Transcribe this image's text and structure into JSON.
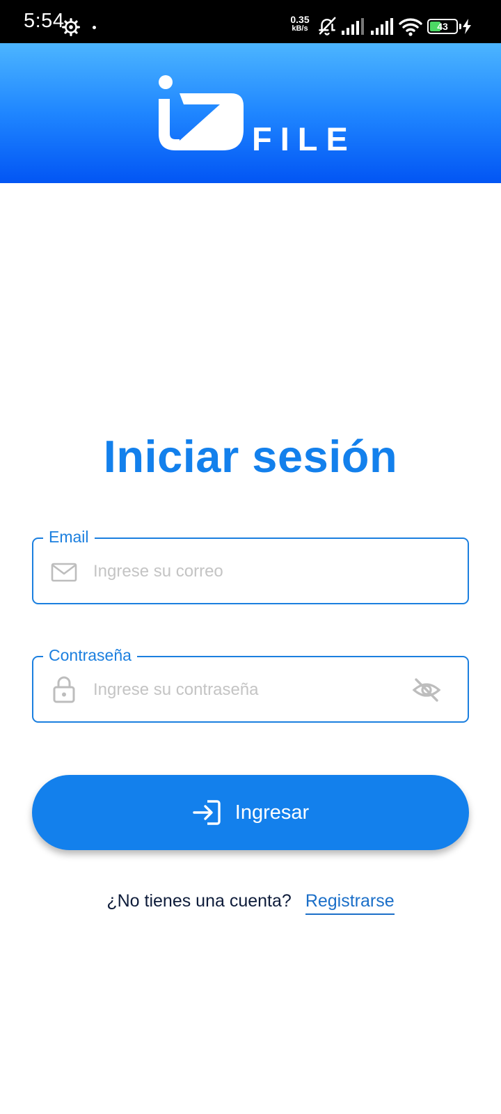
{
  "status_bar": {
    "time": "5:54",
    "net_speed_value": "0.35",
    "net_speed_unit": "kB/s",
    "battery_level": "43",
    "battery_percent": 43,
    "icons": [
      "gear-icon",
      "notifications-off-icon",
      "signal-icon",
      "signal-icon",
      "wifi-icon",
      "battery-icon",
      "charging-bolt-icon"
    ]
  },
  "header": {
    "logo_mark": "IZ",
    "logo_text": "FILE",
    "gradient_top": "#4cb5ff",
    "gradient_bottom": "#0255f4"
  },
  "login": {
    "title": "Iniciar sesión",
    "email": {
      "label": "Email",
      "placeholder": "Ingrese su correo",
      "value": "",
      "icon": "mail-icon"
    },
    "password": {
      "label": "Contraseña",
      "placeholder": "Ingrese su contraseña",
      "value": "",
      "icon": "lock-icon",
      "toggle_icon": "eye-off-icon"
    },
    "submit_label": "Ingresar",
    "submit_icon": "login-icon",
    "signup_question": "¿No tienes una cuenta?",
    "signup_link": "Registrarse"
  },
  "colors": {
    "primary": "#1380ec",
    "field_border": "#1b7fdf",
    "link": "#1b6fc8",
    "text_dark": "#0e1c3a",
    "placeholder": "#c4c4c4"
  }
}
